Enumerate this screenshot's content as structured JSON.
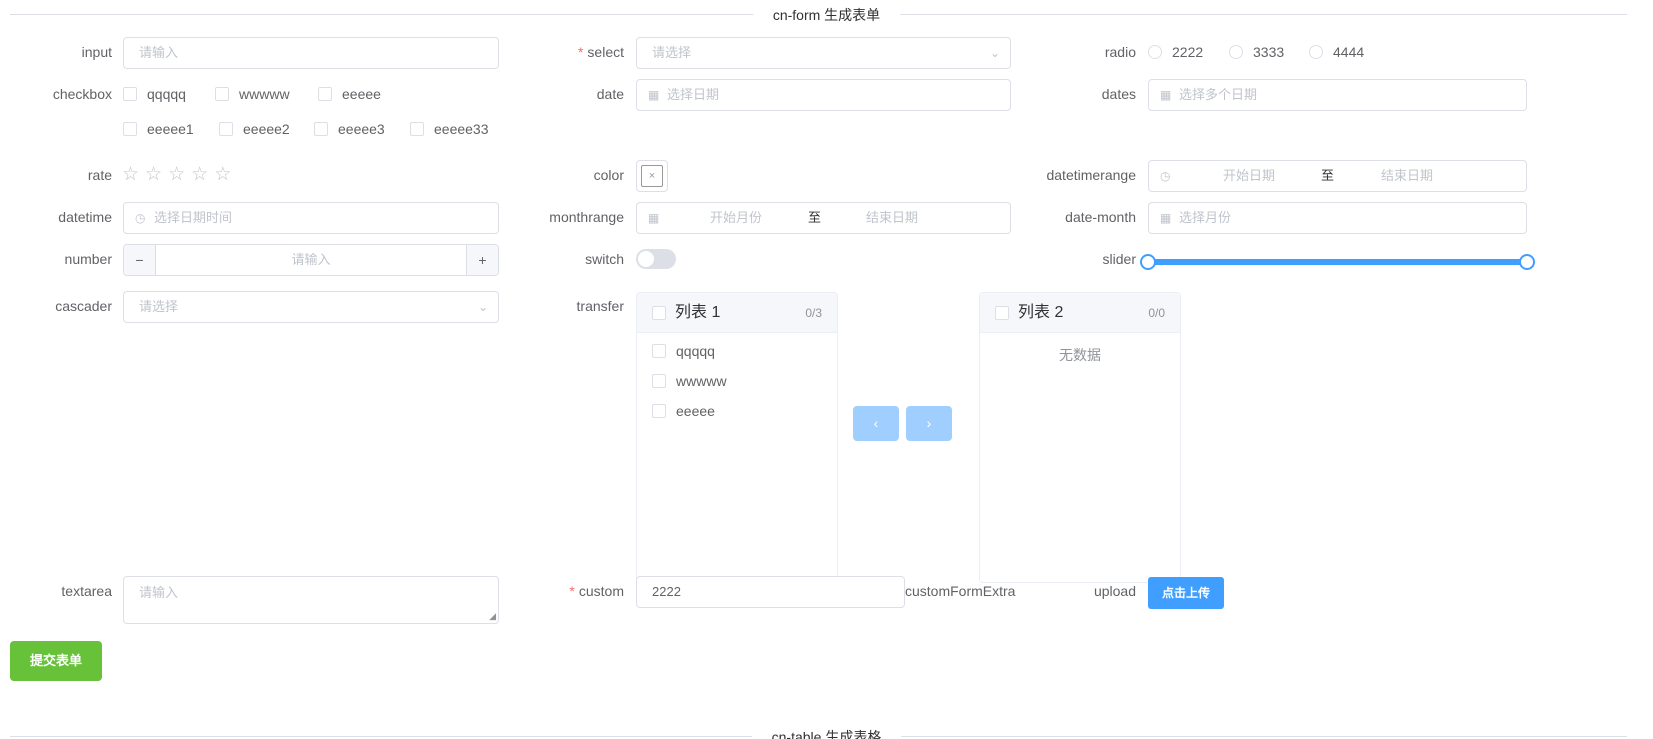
{
  "form_title": "cn-form 生成表单",
  "table_title": "cn-table 生成表格",
  "fields": {
    "input": {
      "label": "input",
      "placeholder": "请输入"
    },
    "select": {
      "label": "select",
      "required": "*",
      "placeholder": "请选择"
    },
    "radio": {
      "label": "radio",
      "options": [
        "2222",
        "3333",
        "4444"
      ]
    },
    "checkbox": {
      "label": "checkbox",
      "options": [
        "qqqqq",
        "wwwww",
        "eeeee",
        "eeeee1",
        "eeeee2",
        "eeeee3",
        "eeeee33"
      ]
    },
    "date": {
      "label": "date",
      "placeholder": "选择日期"
    },
    "dates": {
      "label": "dates",
      "placeholder": "选择多个日期"
    },
    "rate": {
      "label": "rate",
      "value": 0,
      "max": 5
    },
    "color": {
      "label": "color",
      "empty_mark": "×"
    },
    "datetimerange": {
      "label": "datetimerange",
      "start_placeholder": "开始日期",
      "separator": "至",
      "end_placeholder": "结束日期"
    },
    "datetime": {
      "label": "datetime",
      "placeholder": "选择日期时间"
    },
    "monthrange": {
      "label": "monthrange",
      "start_placeholder": "开始月份",
      "separator": "至",
      "end_placeholder": "结束日期"
    },
    "date_month": {
      "label": "date-month",
      "placeholder": "选择月份"
    },
    "number": {
      "label": "number",
      "placeholder": "请输入",
      "minus": "−",
      "plus": "+"
    },
    "switch": {
      "label": "switch",
      "on": false
    },
    "slider": {
      "label": "slider",
      "range_start": 0,
      "range_end": 1
    },
    "cascader": {
      "label": "cascader",
      "placeholder": "请选择"
    },
    "transfer": {
      "label": "transfer",
      "left": {
        "title": "列表 1",
        "count": "0/3",
        "items": [
          "qqqqq",
          "wwwww",
          "eeeee"
        ]
      },
      "right": {
        "title": "列表 2",
        "count": "0/0",
        "empty": "无数据"
      },
      "to_left": "‹",
      "to_right": "›"
    },
    "textarea": {
      "label": "textarea",
      "placeholder": "请输入"
    },
    "custom": {
      "label": "custom",
      "required": "*",
      "value": "2222",
      "extra": "customFormExtra"
    },
    "upload": {
      "label": "upload",
      "button": "点击上传"
    }
  },
  "submit_label": "提交表单",
  "icons": {
    "calendar": "▦",
    "clock": "◷",
    "arrow_down": "⌄",
    "star": "☆"
  },
  "colors": {
    "primary": "#409eff",
    "success": "#67c23a",
    "danger": "#f56c6c",
    "border": "#dcdfe6",
    "placeholder": "#c0c4cc"
  }
}
